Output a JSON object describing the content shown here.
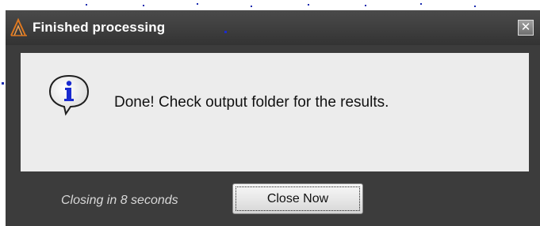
{
  "dialog": {
    "title": "Finished processing",
    "close_glyph": "✕",
    "message": "Done! Check output folder for the results.",
    "countdown": "Closing in 8 seconds",
    "close_now_label": "Close Now"
  },
  "icons": {
    "app": "app-logo-icon",
    "info": "info-icon",
    "close": "close-icon"
  },
  "colors": {
    "titlebar": "#3e3e3e",
    "window_body": "#3c3c3c",
    "content_panel": "#ececec",
    "app_icon_accent": "#e0781e",
    "info_blue": "#1a2bd0"
  }
}
